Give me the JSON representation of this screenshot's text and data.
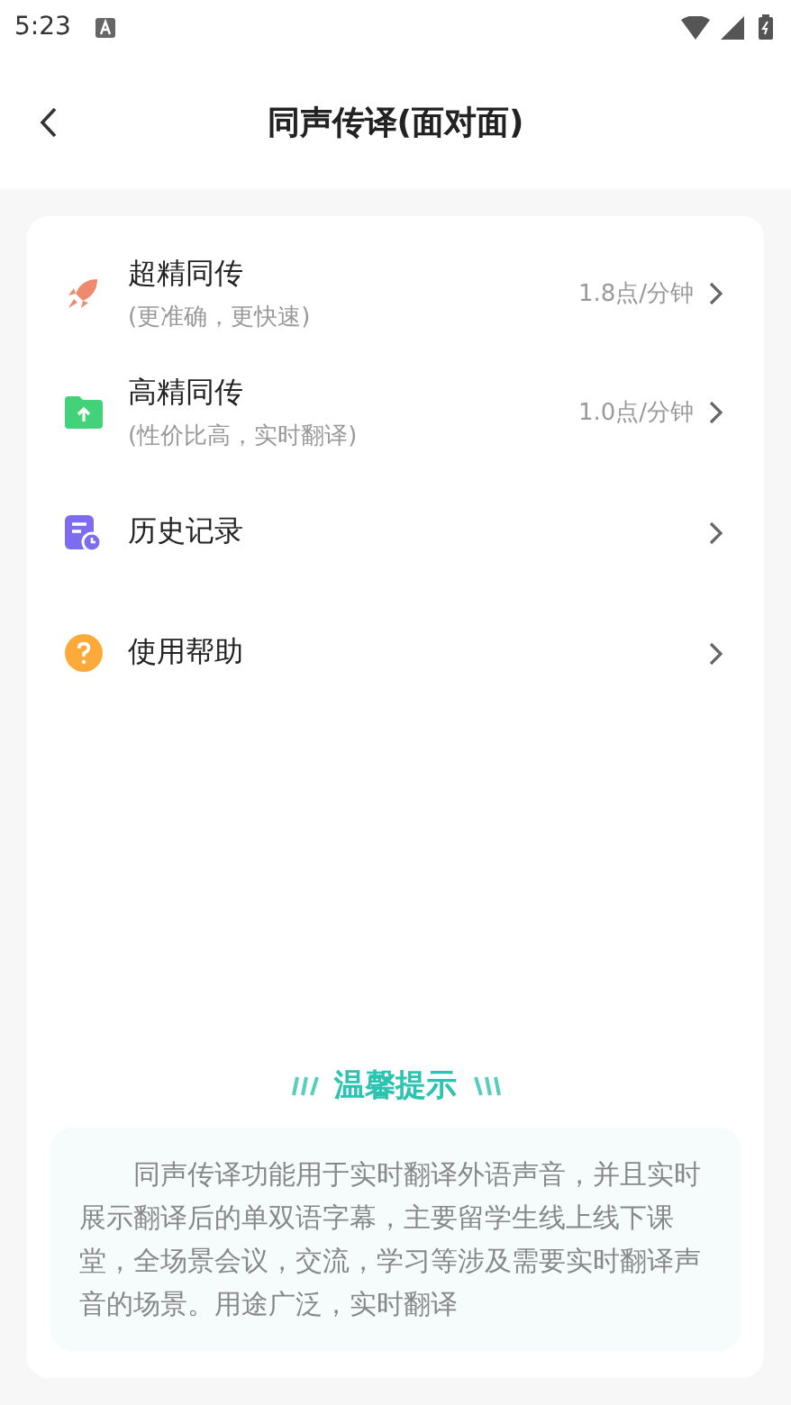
{
  "status_bar": {
    "time": "5:23"
  },
  "header": {
    "title": "同声传译(面对面)"
  },
  "menu": [
    {
      "title": "超精同传",
      "subtitle": "(更准确，更快速)",
      "price": "1.8点/分钟"
    },
    {
      "title": "高精同传",
      "subtitle": "(性价比高，实时翻译)",
      "price": "1.0点/分钟"
    },
    {
      "title": "历史记录"
    },
    {
      "title": "使用帮助"
    }
  ],
  "tips": {
    "title": "温馨提示",
    "text": "同声传译功能用于实时翻译外语声音，并且实时展示翻译后的单双语字幕，主要留学生线上线下课堂，全场景会议，交流，学习等涉及需要实时翻译声音的场景。用途广泛，实时翻译"
  }
}
